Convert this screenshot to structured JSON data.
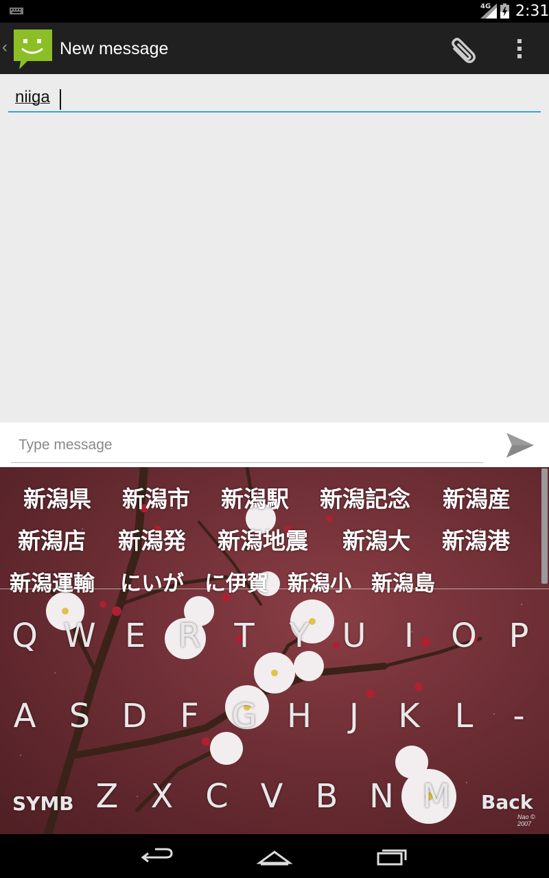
{
  "status_bar": {
    "network": "4G",
    "time": "2:31"
  },
  "action_bar": {
    "title": "New message"
  },
  "to_field": {
    "value": "niiga"
  },
  "compose": {
    "placeholder": "Type message"
  },
  "candidates": [
    {
      "text": "新潟県"
    },
    {
      "text": "新潟市"
    },
    {
      "text": "新潟駅"
    },
    {
      "text": "新潟記念"
    },
    {
      "text": "新潟産"
    },
    {
      "text": "新潟店"
    },
    {
      "text": "新潟発"
    },
    {
      "text": "新潟地震"
    },
    {
      "text": "新潟大"
    },
    {
      "text": "新潟港"
    },
    {
      "text": "新潟運輸"
    },
    {
      "text": "にいが"
    },
    {
      "text": "に伊賀"
    },
    {
      "text": "新潟小"
    },
    {
      "text": "新潟島"
    }
  ],
  "keys": {
    "row1": [
      "Q",
      "W",
      "E",
      "R",
      "T",
      "Y",
      "U",
      "I",
      "O",
      "P"
    ],
    "row2": [
      "A",
      "S",
      "D",
      "F",
      "G",
      "H",
      "J",
      "K",
      "L",
      "-"
    ],
    "row3": [
      "Z",
      "X",
      "C",
      "V",
      "B",
      "N",
      "M"
    ],
    "symb": "SYMB",
    "back": "Back"
  },
  "wallpaper_credit": "Nao © 2007",
  "colors": {
    "accent": "#33a5d4",
    "action_bar": "#202020",
    "app_icon": "#8cbf26"
  }
}
